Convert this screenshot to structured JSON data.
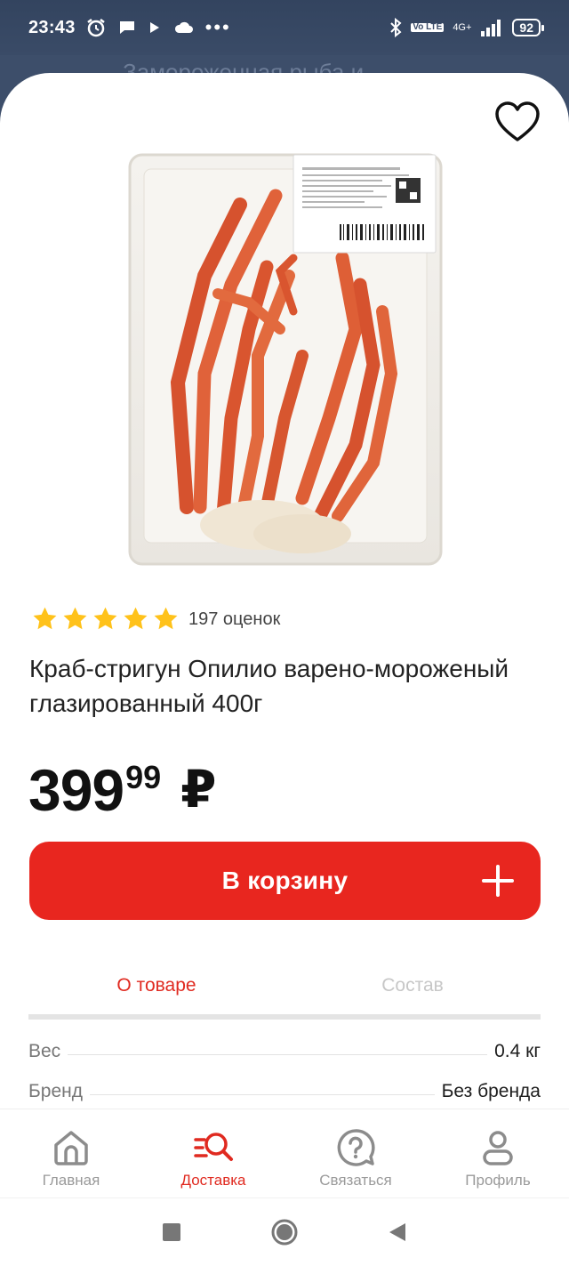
{
  "status_bar": {
    "time": "23:43",
    "battery": "92",
    "network": "4G+",
    "volte": "Vo LTE"
  },
  "background": {
    "title": "Замороженная рыба и"
  },
  "product": {
    "rating_stars": 5,
    "rating_count": "197 оценок",
    "title": "Краб-стригун Опилио варено-мороженый глазированный 400г",
    "price_rub": "399",
    "price_kop": "99",
    "currency": "₽"
  },
  "cart": {
    "label": "В корзину"
  },
  "tabs": [
    {
      "label": "О товаре",
      "active": true
    },
    {
      "label": "Состав",
      "active": false
    }
  ],
  "specs": [
    {
      "key": "Вес",
      "value": "0.4 кг"
    },
    {
      "key": "Бренд",
      "value": "Без бренда"
    }
  ],
  "nav": [
    {
      "label": "Главная",
      "icon": "home-icon"
    },
    {
      "label": "Доставка",
      "icon": "delivery-search-icon",
      "active": true
    },
    {
      "label": "Связаться",
      "icon": "help-icon"
    },
    {
      "label": "Профиль",
      "icon": "profile-icon"
    }
  ],
  "colors": {
    "accent": "#e8261f",
    "star": "#ffc21a",
    "header_bg": "#3a4b67"
  }
}
